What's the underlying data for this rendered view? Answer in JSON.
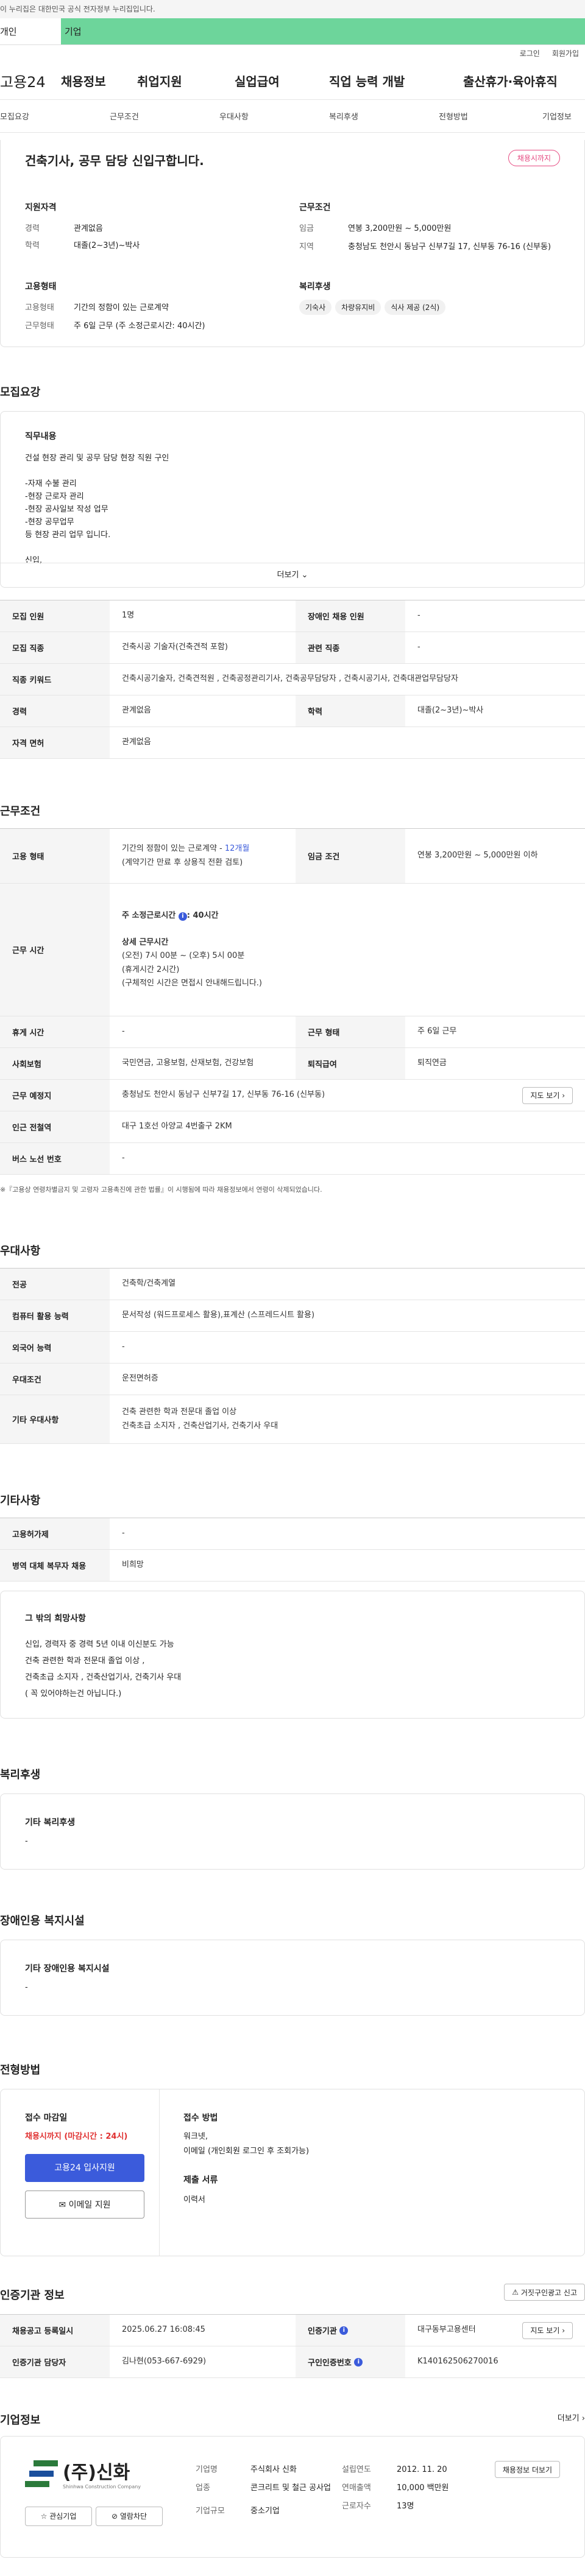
{
  "gov_banner": "이 누리집은 대한민국 공식 전자정부 누리집입니다.",
  "top_tabs": {
    "personal": "개인",
    "company": "기업"
  },
  "util": {
    "login": "로그인",
    "join": "회원가입"
  },
  "gnb": {
    "logo": "고용24",
    "items": [
      "채용정보",
      "취업지원",
      "실업급여",
      "직업 능력 개발",
      "출산휴가·육아휴직"
    ]
  },
  "snb": [
    "모집요강",
    "근무조건",
    "우대사항",
    "복리후생",
    "전형방법",
    "기업정보"
  ],
  "summary": {
    "title": "건축기사, 공무 담당 신입구합니다.",
    "badge": "채용시까지",
    "req_title": "지원자격",
    "career_k": "경력",
    "career_v": "관계없음",
    "edu_k": "학력",
    "edu_v": "대졸(2~3년)~박사",
    "cond_title": "근무조건",
    "pay_k": "임금",
    "pay_v": "연봉 3,200만원 ~ 5,000만원",
    "area_k": "지역",
    "area_v": "충청남도 천안시 동남구 신부7길 17, 신부동 76-16 (신부동)",
    "form_title": "고용형태",
    "form_k": "고용형태",
    "form_v": "기간의 정함이 있는 근로계약",
    "time_k": "근무형태",
    "time_v": "주 6일 근무 (주 소정근로시간: 40시간)",
    "welfare_title": "복리후생",
    "chips": [
      "기숙사",
      "차량유지비",
      "식사 제공 (2식)"
    ]
  },
  "recruit": {
    "heading": "모집요강",
    "job_title": "직무내용",
    "job_lines": [
      "건설 현장 관리 및 공무 담당 현장 직원 구인",
      "",
      "-자재 수불 관리",
      "-현장 근로자 관리",
      "-현장 공사일보 작성 업무",
      "-현장 공무업무",
      "등 현장 관리 업무 입니다.",
      "",
      "신입,"
    ],
    "more": "더보기",
    "rows": [
      [
        "모집 인원",
        "1명",
        "장애인 채용 인원",
        "-"
      ],
      [
        "모집 직종",
        "건축시공 기술자(건축견적 포함)",
        "관련 직종",
        "-"
      ],
      [
        "직종 키워드",
        "건축시공기술자, 건축견적원 , 건축공정관리기사, 건축공무담당자 , 건축시공기사, 건축대관업무담당자",
        "",
        ""
      ],
      [
        "경력",
        "관계없음",
        "학력",
        "대졸(2~3년)~박사"
      ],
      [
        "자격 면허",
        "관계없음",
        "",
        ""
      ]
    ]
  },
  "work": {
    "heading": "근무조건",
    "type_k": "고용 형태",
    "type_v1": "기간의 정함이 있는 근로계약 - ",
    "type_v1b": "12개월",
    "type_v2": "(계약기간 만료 후 상용직 전환 검토)",
    "wage_k": "임금 조건",
    "wage_v": "연봉 3,200만원 ~ 5,000만원 이하",
    "hours_k": "근무 시간",
    "hours_a": "주 소정근로시간 ",
    "hours_icon": "i",
    "hours_a2": ": 40시간",
    "hours_b": "상세 근무시간",
    "hours_lines": [
      "(오전) 7시 00분 ~ (오후) 5시 00분",
      "(휴게시간 2시간)",
      "(구체적인 시간은 면접시 안내해드립니다.)"
    ],
    "rest_k": "휴게 시간",
    "rest_v": "-",
    "form_k": "근무 형태",
    "form_v": "주 6일 근무",
    "ins_k": "사회보험",
    "ins_v": "국민연금, 고용보험, 산재보험, 건강보험",
    "ret_k": "퇴직급여",
    "ret_v": "퇴직연금",
    "place_k": "근무 예정지",
    "place_v": "충청남도 천안시 동남구 신부7길 17, 신부동 76-16 (신부동)",
    "map": "지도 보기",
    "sub_k": "인근 전철역",
    "sub_v": "대구 1호선 아양교 4번출구 2KM",
    "bus_k": "버스 노선 번호",
    "bus_v": "-",
    "note": "※『고용상 연령차별금지 및 고령자 고용촉진에 관한 법률』이 시행됨에 따라 채용정보에서 연령이 삭제되었습니다."
  },
  "pref": {
    "heading": "우대사항",
    "rows": [
      [
        "전공",
        "건축학/건축계열"
      ],
      [
        "컴퓨터 활용 능력",
        "문서작성 (워드프로세스 활용),표계산 (스프레드시트 활용)"
      ],
      [
        "외국어 능력",
        "-"
      ],
      [
        "우대조건",
        "운전면허증"
      ],
      [
        "기타 우대사항",
        "건축 관련한 학과 전문대 졸업 이상\n건축초급 소지자 , 건축산업기사, 건축기사  우대"
      ]
    ]
  },
  "etc": {
    "heading": "기타사항",
    "rows": [
      [
        "고용허가제",
        "-"
      ],
      [
        "병역 대체 복무자 채용",
        "비희망"
      ]
    ],
    "box_title": "그 밖의 희망사항",
    "box_lines": [
      "신입, 경력자 중 경력 5년 이내 이신분도 가능",
      "건축 관련한 학과 전문대 졸업 이상 ,",
      "건축초급 소지자 , 건축산업기사, 건축기사  우대",
      "( 꼭 있어야하는건 아닙니다.)"
    ]
  },
  "welfare": {
    "heading": "복리후생",
    "label": "기타 복리후생",
    "value": "-"
  },
  "disabled": {
    "heading": "장애인용 복지시설",
    "label": "기타 장애인용 복지시설",
    "value": "-"
  },
  "process": {
    "heading": "전형방법",
    "deadline_t": "접수 마감일",
    "deadline_v": "채용시까지 (마감시간 : 24시)",
    "apply_btn": "고용24 입사지원",
    "email_btn": "이메일 지원",
    "method_t": "접수 방법",
    "method_lines": [
      "워크넷,",
      "이메일 (개인회원 로그인 후 조회가능)"
    ],
    "docs_t": "제출 서류",
    "docs_v": "이력서"
  },
  "agency": {
    "heading": "인증기관 정보",
    "report_btn": "거짓구인광고 신고",
    "rows": [
      [
        "채용공고 등록일시",
        "2025.06.27 16:08:45",
        "인증기관",
        "대구동부고용센터"
      ],
      [
        "인증기관 담당자",
        "김나현(053-667-6929)",
        "구인인증번호",
        "K140162506270016"
      ]
    ],
    "map": "지도 보기"
  },
  "company": {
    "heading": "기업정보",
    "more": "더보기",
    "logo": "(주)신화",
    "logo_sub": "Shinhwa Construction Company",
    "fav": "관심기업",
    "block": "열람차단",
    "name_k": "기업명",
    "name_v": "주식회사 신화",
    "ind_k": "업종",
    "ind_v": "콘크리트 및 철근 공사업",
    "size_k": "기업규모",
    "size_v": "중소기업",
    "est_k": "설립연도",
    "est_v": "2012. 11. 20",
    "sales_k": "연매출액",
    "sales_v": "10,000 백만원",
    "emp_k": "근로자수",
    "emp_v": "13명",
    "list_btn": "채용정보 더보기"
  },
  "colors": {
    "green": "#6dd59b",
    "blue": "#3b5bdb",
    "red": "#e03131",
    "pink": "#e64980"
  }
}
